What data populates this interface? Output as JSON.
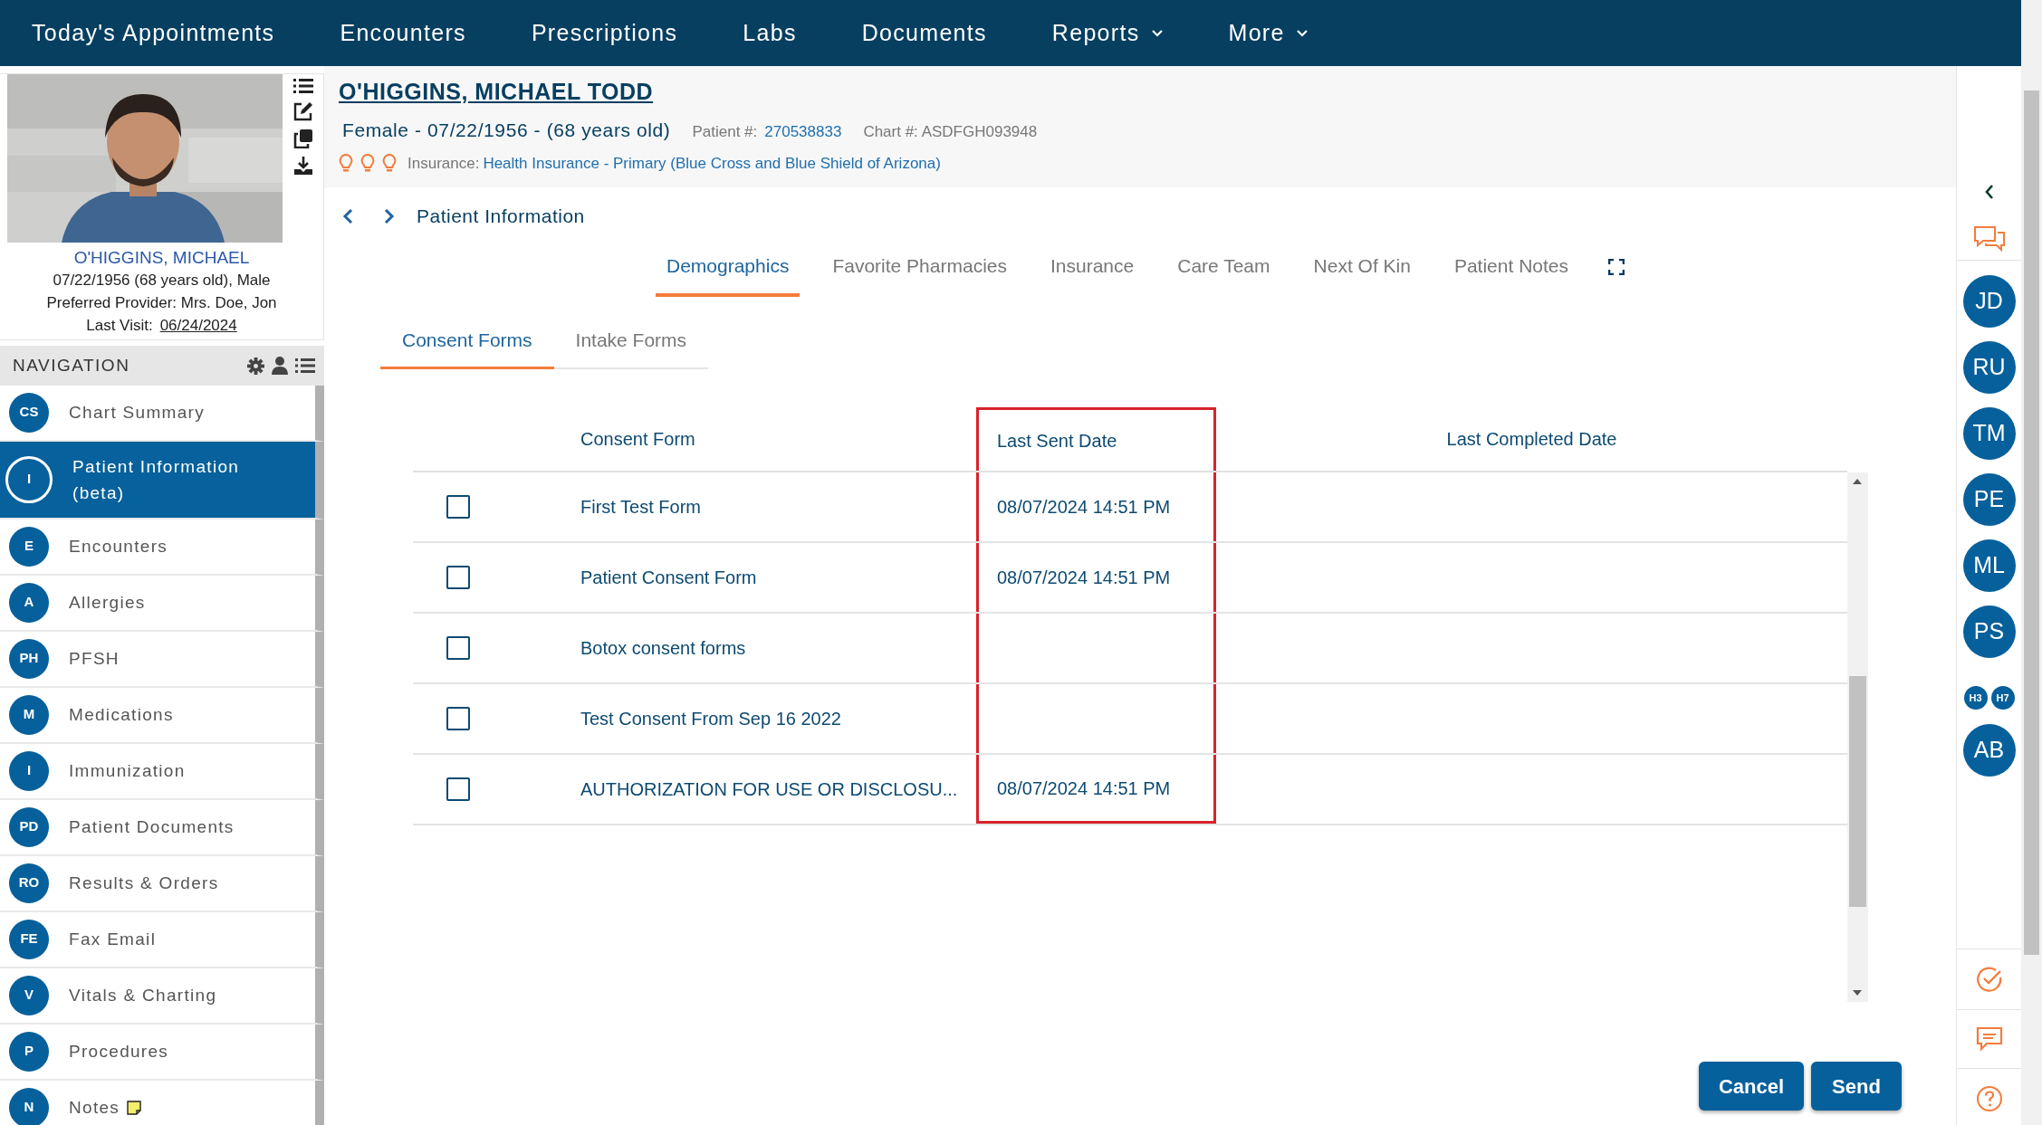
{
  "top_nav": {
    "items": [
      {
        "label": "Today's Appointments",
        "dropdown": false
      },
      {
        "label": "Encounters",
        "dropdown": false
      },
      {
        "label": "Prescriptions",
        "dropdown": false
      },
      {
        "label": "Labs",
        "dropdown": false
      },
      {
        "label": "Documents",
        "dropdown": false
      },
      {
        "label": "Reports",
        "dropdown": true
      },
      {
        "label": "More",
        "dropdown": true
      }
    ]
  },
  "patient_card": {
    "name": "O'HIGGINS, MICHAEL",
    "dob_line": "07/22/1956 (68 years old), Male",
    "provider": "Preferred Provider: Mrs. Doe, Jon",
    "last_visit_label": "Last Visit:",
    "last_visit": "06/24/2024"
  },
  "navigation": {
    "title": "NAVIGATION",
    "items": [
      {
        "badge": "CS",
        "label": "Chart Summary",
        "selected": false,
        "has_note": false
      },
      {
        "badge": "I",
        "label": "Patient Information (beta)",
        "selected": true,
        "has_note": false
      },
      {
        "badge": "E",
        "label": "Encounters",
        "selected": false,
        "has_note": false
      },
      {
        "badge": "A",
        "label": "Allergies",
        "selected": false,
        "has_note": false
      },
      {
        "badge": "PH",
        "label": "PFSH",
        "selected": false,
        "has_note": false
      },
      {
        "badge": "M",
        "label": "Medications",
        "selected": false,
        "has_note": false
      },
      {
        "badge": "I",
        "label": "Immunization",
        "selected": false,
        "has_note": false
      },
      {
        "badge": "PD",
        "label": "Patient Documents",
        "selected": false,
        "has_note": false
      },
      {
        "badge": "RO",
        "label": "Results & Orders",
        "selected": false,
        "has_note": false
      },
      {
        "badge": "FE",
        "label": "Fax Email",
        "selected": false,
        "has_note": false
      },
      {
        "badge": "V",
        "label": "Vitals & Charting",
        "selected": false,
        "has_note": false
      },
      {
        "badge": "P",
        "label": "Procedures",
        "selected": false,
        "has_note": false
      },
      {
        "badge": "N",
        "label": "Notes",
        "selected": false,
        "has_note": true
      }
    ]
  },
  "patient_header": {
    "name": "O'HIGGINS, MICHAEL TODD",
    "summary": "Female - 07/22/1956 - (68 years old)",
    "patient_no_label": "Patient #:",
    "patient_no": "270538833",
    "chart_no": "Chart #: ASDFGH093948",
    "insurance_label": "Insurance:",
    "insurance": "Health Insurance - Primary (Blue Cross and Blue Shield of Arizona)"
  },
  "breadcrumb": "Patient Information",
  "tabs": [
    {
      "label": "Demographics",
      "selected": true
    },
    {
      "label": "Favorite Pharmacies",
      "selected": false
    },
    {
      "label": "Insurance",
      "selected": false
    },
    {
      "label": "Care Team",
      "selected": false
    },
    {
      "label": "Next Of Kin",
      "selected": false
    },
    {
      "label": "Patient Notes",
      "selected": false
    }
  ],
  "sub_tabs": [
    {
      "label": "Consent Forms",
      "selected": true
    },
    {
      "label": "Intake Forms",
      "selected": false
    }
  ],
  "table": {
    "columns": [
      {
        "label": "Consent Form",
        "highlighted": false
      },
      {
        "label": "Last Sent Date",
        "highlighted": true
      },
      {
        "label": "Last Completed Date",
        "highlighted": false
      }
    ],
    "rows": [
      {
        "checked": false,
        "form": "First Test Form",
        "last_sent": "08/07/2024 14:51 PM"
      },
      {
        "checked": false,
        "form": "Patient Consent Form",
        "last_sent": "08/07/2024 14:51 PM"
      },
      {
        "checked": false,
        "form": "Botox consent forms"
      },
      {
        "checked": false,
        "form": "Test Consent From Sep 16 2022"
      },
      {
        "checked": false,
        "form": "AUTHORIZATION FOR USE OR DISCLOSU...",
        "last_sent": "08/07/2024 14:51 PM"
      }
    ]
  },
  "buttons": [
    "Cancel",
    "Send"
  ],
  "right_rail": {
    "avatars": [
      {
        "initials": "JD",
        "kind": "avatar"
      },
      {
        "initials": "RU",
        "kind": "avatar"
      },
      {
        "initials": "TM",
        "kind": "avatar"
      },
      {
        "initials": "PE",
        "kind": "avatar"
      },
      {
        "initials": "ML",
        "kind": "avatar"
      },
      {
        "initials": "PS",
        "kind": "avatar"
      },
      {
        "initials": "H3",
        "kind": "mini"
      },
      {
        "initials": "H7",
        "kind": "mini"
      },
      {
        "initials": "AB",
        "kind": "avatar"
      }
    ]
  }
}
